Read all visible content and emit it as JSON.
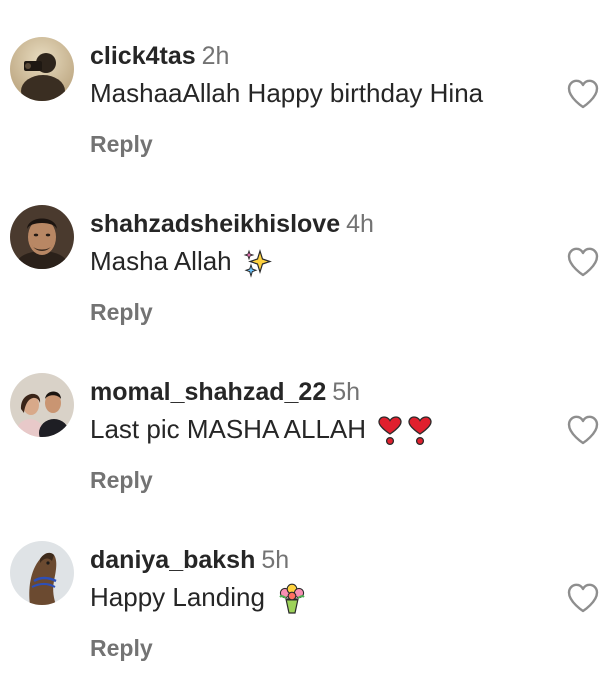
{
  "comments": [
    {
      "username": "click4tas",
      "time": "2h",
      "text": "MashaaAllah Happy birthday Hina",
      "emojis": [],
      "reply_label": "Reply",
      "avatar_icon": "person-with-camera-avatar"
    },
    {
      "username": "shahzadsheikhislove",
      "time": "4h",
      "text": "Masha Allah",
      "emojis": [
        "sparkles-emoji"
      ],
      "reply_label": "Reply",
      "avatar_icon": "man-portrait-avatar"
    },
    {
      "username": "momal_shahzad_22",
      "time": "5h",
      "text": "Last pic MASHA ALLAH",
      "emojis": [
        "heart-exclamation-emoji",
        "heart-exclamation-emoji"
      ],
      "reply_label": "Reply",
      "avatar_icon": "couple-portrait-avatar"
    },
    {
      "username": "daniya_baksh",
      "time": "5h",
      "text": "Happy Landing",
      "emojis": [
        "bouquet-emoji"
      ],
      "reply_label": "Reply",
      "avatar_icon": "horse-avatar"
    }
  ],
  "icons": {
    "like": "heart-outline-icon"
  },
  "colors": {
    "text": "#262626",
    "secondary": "#737373",
    "background": "#ffffff"
  }
}
